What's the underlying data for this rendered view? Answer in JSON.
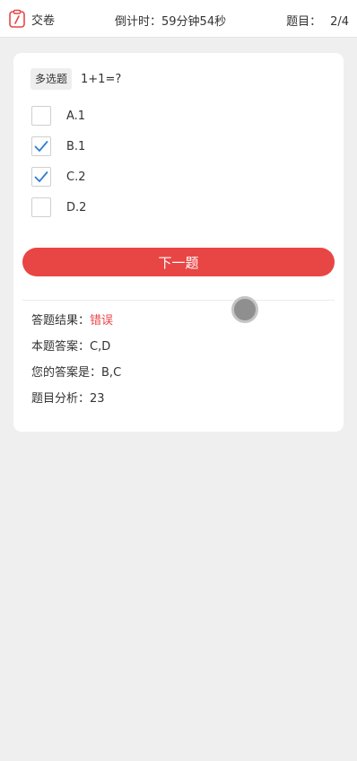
{
  "header": {
    "submit_label": "交卷",
    "countdown": "倒计时：59分钟54秒",
    "progress_label": "题目：",
    "progress_value": "2/4",
    "accent_color": "#e84545"
  },
  "question": {
    "type_tag": "多选题",
    "text": "1+1=?",
    "options": [
      {
        "label": "A.1",
        "checked": false
      },
      {
        "label": "B.1",
        "checked": true
      },
      {
        "label": "C.2",
        "checked": true
      },
      {
        "label": "D.2",
        "checked": false
      }
    ],
    "next_button": "下一题"
  },
  "result": {
    "result_label": "答题结果：",
    "result_value": "错误",
    "answer_label": "本题答案：",
    "answer_value": "C,D",
    "your_answer_label": "您的答案是：",
    "your_answer_value": "B,C",
    "analysis_label": "题目分析：",
    "analysis_value": "23"
  }
}
